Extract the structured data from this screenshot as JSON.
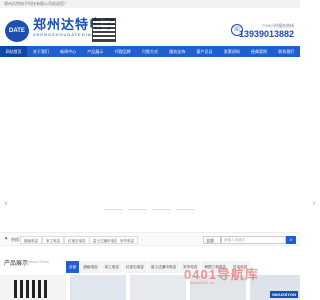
{
  "topbar": {
    "text": "郑州达特电子科技有限公司欢迎您！"
  },
  "header": {
    "logo_text": "DATE",
    "brand_cn": "郑州达特电子",
    "brand_en": "ZHENGZHOUDATEDIANZI",
    "hotline_label": "7*24小时服务热线",
    "hotline": "13939013882"
  },
  "nav": {
    "items": [
      "网站首页",
      "关于我们",
      "新闻中心",
      "产品展示",
      "代理品牌",
      "付款方式",
      "服务支持",
      "客户见证",
      "发票须知",
      "经典案例",
      "联系我们"
    ]
  },
  "search": {
    "hot_label": "热搜：",
    "keywords": [
      "超级电容",
      "军工电容",
      "红宝石电容",
      "富士达通讯电容",
      "安华电容"
    ],
    "select_value": "全部",
    "placeholder": "请输入关键字",
    "button_icon": "search-icon"
  },
  "products": {
    "title": "产品展示",
    "subtitle": "Product Show",
    "tabs": [
      "全部",
      "超级电容",
      "军工电容",
      "红宝石电容",
      "富士达通讯电容",
      "安华电容",
      "韩国三和电容",
      "日本电容",
      "日本通讯电容"
    ]
  },
  "watermark": {
    "text": "0401导航库",
    "sub": "www.0401.cn"
  },
  "thumb_tag": "INDUXSYON"
}
